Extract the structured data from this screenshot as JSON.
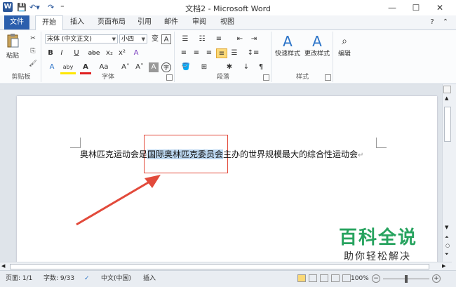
{
  "window": {
    "title": "文档2 - Microsoft Word",
    "minimize": "—",
    "maximize": "☐",
    "close": "✕"
  },
  "quick_access": {
    "app_icon": "W",
    "save": "💾",
    "undo": "↶▾",
    "redo": "↷",
    "customize": "⁼"
  },
  "tabs": [
    {
      "label": "文件"
    },
    {
      "label": "开始"
    },
    {
      "label": "插入"
    },
    {
      "label": "页面布局"
    },
    {
      "label": "引用"
    },
    {
      "label": "邮件"
    },
    {
      "label": "审阅"
    },
    {
      "label": "视图"
    }
  ],
  "ribbon_right": {
    "help": "?",
    "collapse": "⌃"
  },
  "ribbon": {
    "clipboard": {
      "label": "剪贴板",
      "paste": "粘贴"
    },
    "font": {
      "label": "字体",
      "font_name": "宋体 (中文正文)",
      "font_size": "小四",
      "wen": "变",
      "A_box": "A",
      "bold": "B",
      "italic": "I",
      "underline": "U",
      "strike": "abe",
      "sub": "x₂",
      "sup": "x²",
      "clear": "A",
      "highlight": "aby",
      "color": "A",
      "case": "Aa",
      "grow": "A˄",
      "shrink": "A˅",
      "char_shade": "A",
      "enclose": "字"
    },
    "paragraph": {
      "label": "段落"
    },
    "styles": {
      "label": "样式",
      "quick": "快速样式",
      "change": "更改样式"
    },
    "editing": {
      "label": "编辑"
    }
  },
  "document": {
    "text_before": "奥林匹克运动会是",
    "text_selected": "国际奥林匹克委员会",
    "text_after": "主办的世界规模最大的综合性运动会",
    "para_mark": "↵"
  },
  "status": {
    "page": "页面: 1/1",
    "words": "字数: 9/33",
    "language": "中文(中国)",
    "insert": "插入",
    "zoom": "100%",
    "zoom_minus": "−",
    "zoom_plus": "+"
  },
  "watermark": {
    "title": "百科全说",
    "subtitle": "助你轻松解决"
  },
  "colors": {
    "accent": "#2b579a",
    "file_tab": "#2b5fad",
    "callout": "#e24a3b",
    "watermark": "#27a35f",
    "selection": "#bcd7f0"
  }
}
